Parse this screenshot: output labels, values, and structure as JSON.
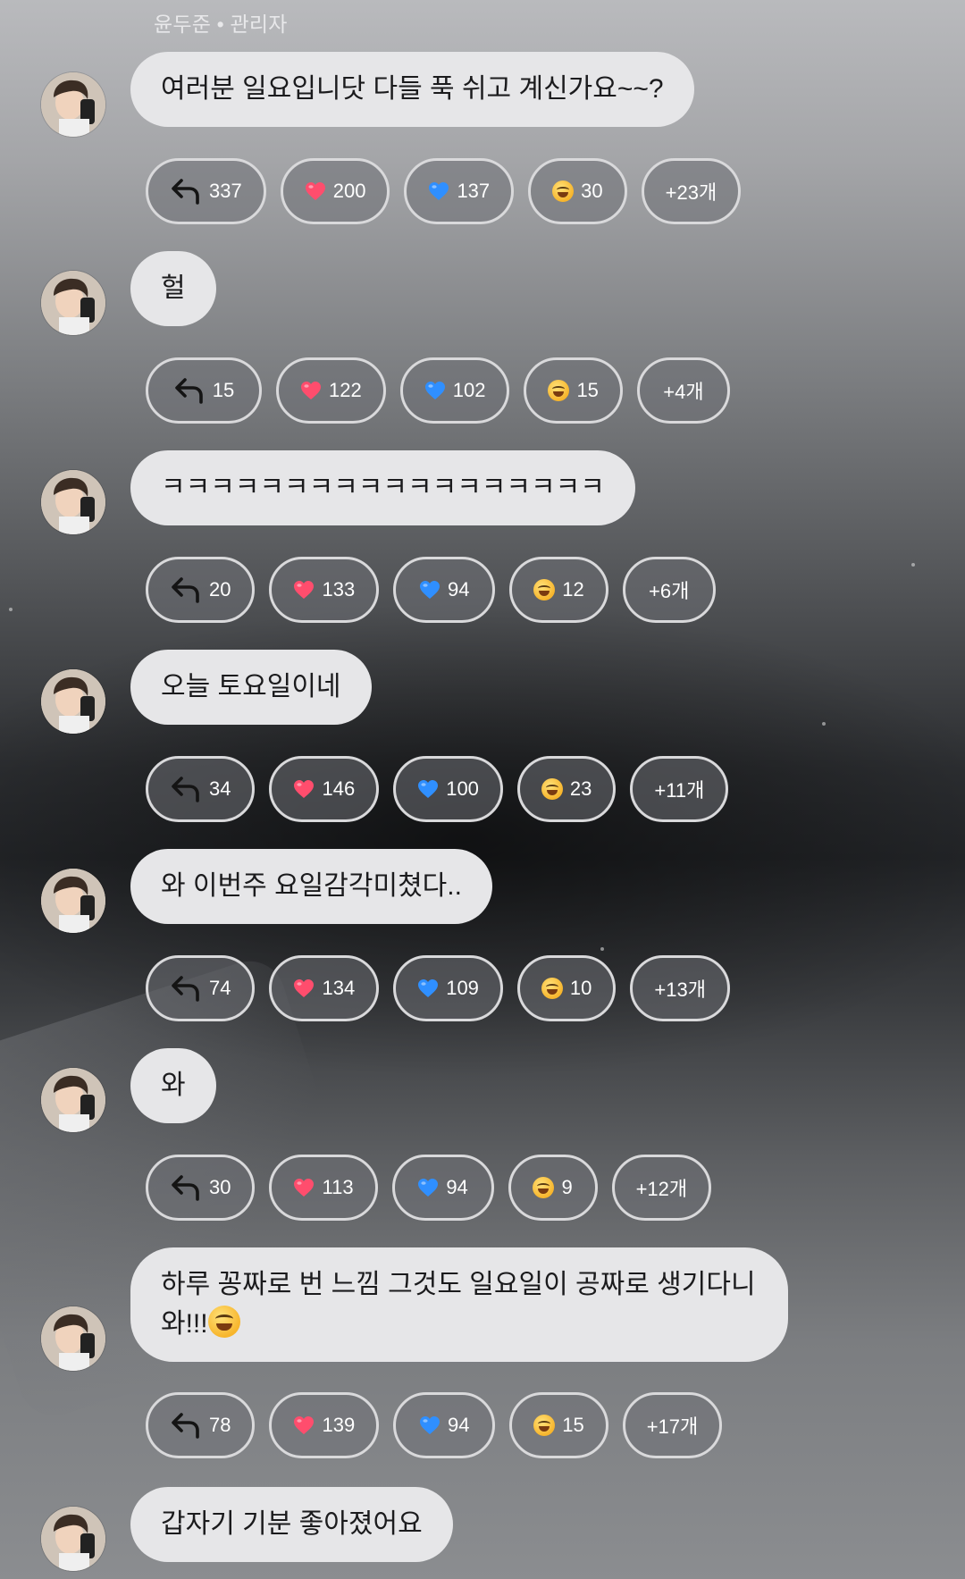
{
  "header": {
    "author_label": "윤두준 • 관리자"
  },
  "messages": [
    {
      "text": "여러분 일요입니닷 다들 푹 쉬고 계신가요~~?",
      "reply": "337",
      "heart": "200",
      "blue_heart": "137",
      "emoji": "30",
      "emoji_icon": "laughing-tears-icon",
      "more": "+23개"
    },
    {
      "text": "헐",
      "reply": "15",
      "heart": "122",
      "blue_heart": "102",
      "emoji": "15",
      "emoji_icon": "laughing-tears-icon",
      "more": "+4개"
    },
    {
      "text": "ㅋㅋㅋㅋㅋㅋㅋㅋㅋㅋㅋㅋㅋㅋㅋㅋㅋㅋ",
      "reply": "20",
      "heart": "133",
      "blue_heart": "94",
      "emoji": "12",
      "emoji_icon": "rofl-icon",
      "more": "+6개"
    },
    {
      "text": "오늘 토요일이네",
      "reply": "34",
      "heart": "146",
      "blue_heart": "100",
      "emoji": "23",
      "emoji_icon": "laughing-tears-icon",
      "more": "+11개"
    },
    {
      "text": "와 이번주 요일감각미쳤다..",
      "reply": "74",
      "heart": "134",
      "blue_heart": "109",
      "emoji": "10",
      "emoji_icon": "laughing-tears-icon",
      "more": "+13개"
    },
    {
      "text": "와",
      "reply": "30",
      "heart": "113",
      "blue_heart": "94",
      "emoji": "9",
      "emoji_icon": "smile-icon",
      "more": "+12개"
    },
    {
      "text": "하루 꽁짜로 번 느낌 그것도 일요일이 공짜로 생기다니\n와!!!",
      "reply": "78",
      "heart": "139",
      "blue_heart": "94",
      "emoji": "15",
      "emoji_icon": "rofl-icon",
      "more": "+17개"
    },
    {
      "text": "갑자기 기분 좋아졌어요"
    }
  ],
  "colors": {
    "bubble": "#e6e6e8",
    "chip_border": "#d9d9db",
    "heart": "#ff4d6d",
    "blue_heart": "#2f8fff"
  }
}
